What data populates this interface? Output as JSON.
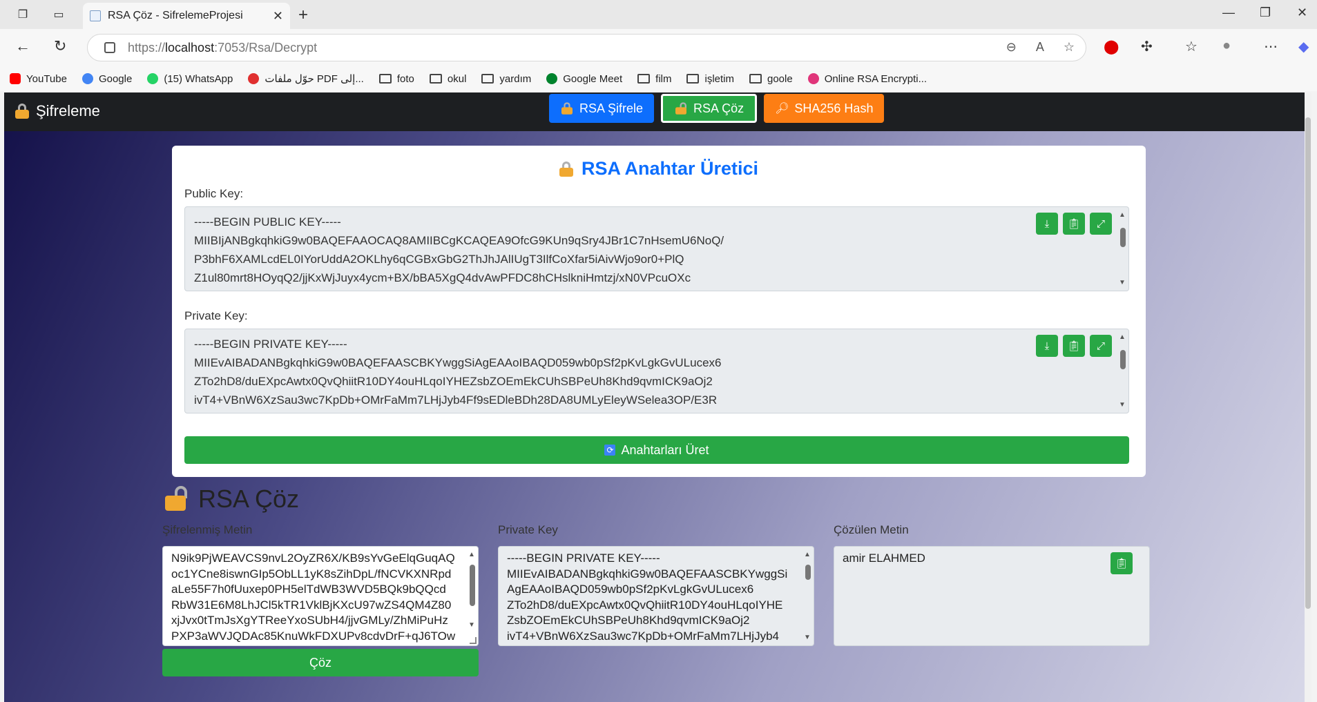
{
  "browser": {
    "tab_title": "RSA Çöz - SifrelemeProjesi",
    "url_prefix": "https://",
    "url_host": "localhost",
    "url_rest": ":7053/Rsa/Decrypt",
    "bookmarks": [
      {
        "label": "YouTube",
        "icon": "youtube-icon",
        "color": "#ff0000"
      },
      {
        "label": "Google",
        "icon": "google-icon",
        "color": "#4285f4"
      },
      {
        "label": "(15) WhatsApp",
        "icon": "whatsapp-icon",
        "color": "#25d366"
      },
      {
        "label": "حوّل ملفات PDF إلى...",
        "icon": "heart-icon",
        "color": "#e03030"
      },
      {
        "label": "foto",
        "icon": "folder-icon"
      },
      {
        "label": "okul",
        "icon": "folder-icon"
      },
      {
        "label": "yardım",
        "icon": "folder-icon"
      },
      {
        "label": "Google Meet",
        "icon": "meet-icon",
        "color": "#00832d"
      },
      {
        "label": "film",
        "icon": "folder-icon"
      },
      {
        "label": "işletim",
        "icon": "folder-icon"
      },
      {
        "label": "goole",
        "icon": "folder-icon"
      },
      {
        "label": "Online RSA Encrypti...",
        "icon": "rsa-site-icon",
        "color": "#e0357a"
      }
    ]
  },
  "app": {
    "brand": "Şifreleme",
    "nav": {
      "encrypt": "RSA Şifrele",
      "decrypt": "RSA Çöz",
      "hash": "SHA256 Hash"
    },
    "colors": {
      "blue": "#0d6efd",
      "green": "#28a745",
      "orange": "#fd7e14"
    }
  },
  "generator": {
    "title": "RSA Anahtar Üretici",
    "public_label": "Public Key:",
    "public_key": "-----BEGIN PUBLIC KEY-----\nMIIBIjANBgkqhkiG9w0BAQEFAAOCAQ8AMIIBCgKCAQEA9OfcG9KUn9qSry4JBr1C7nHsemU6NoQ/\nP3bhF6XAMLcdEL0IYorUddA2OKLhy6qCGBxGbG2ThJhJAlIUgT3IlfCoXfar5iAivWjo9or0+PlQ\nZ1ul80mrt8HOyqQ2/jjKxWjJuyx4ycm+BX/bBA5XgQ4dvAwPFDC8hCHslkniHmtzj/xN0VPcuOXc",
    "private_label": "Private Key:",
    "private_key": "-----BEGIN PRIVATE KEY-----\nMIIEvAIBADANBgkqhkiG9w0BAQEFAASCBKYwggSiAgEAAoIBAQD059wb0pSf2pKvLgkGvULucex6\nZTo2hD8/duEXpcAwtx0QvQhiitR10DY4ouHLqoIYHEZsbZOEmEkCUhSBPeUh8Khd9qvmICK9aOj2\nivT4+VBnW6XzSau3wc7KpDb+OMrFaMm7LHjJyb4Ff9sEDleBDh28DA8UMLyEleyWSelea3OP/E3R",
    "generate_label": "Anahtarları Üret"
  },
  "decrypt": {
    "title": "RSA Çöz",
    "cipher_label": "Şifrelenmiş Metin",
    "cipher_text": "N9ik9PjWEAVCS9nvL2OyZR6X/KB9sYvGeElqGuqAQ\noc1YCne8iswnGIp5ObLL1yK8sZihDpL/fNCVKXNRpd\naLe55F7h0fUuxep0PH5elTdWB3WVD5BQk9bQQcd\nRbW31E6M8LhJCl5kTR1VklBjKXcU97wZS4QM4Z80\nxjJvx0tTmJsXgYTReeYxoSUbH4/jjvGMLy/ZhMiPuHz\nPXP3aWVJQDAc85KnuWkFDXUPv8cdvDrF+qJ6TOw",
    "key_label": "Private Key",
    "key_text": "-----BEGIN PRIVATE KEY-----\nMIIEvAIBADANBgkqhkiG9w0BAQEFAASCBKYwggSi\nAgEAAoIBAQD059wb0pSf2pKvLgkGvULucex6\nZTo2hD8/duEXpcAwtx0QvQhiitR10DY4ouHLqoIYHE\nZsbZOEmEkCUhSBPeUh8Khd9qvmICK9aOj2\nivT4+VBnW6XzSau3wc7KpDb+OMrFaMm7LHjJyb4",
    "result_label": "Çözülen Metin",
    "result_text": "amir ELAHMED",
    "button_label": "Çöz"
  }
}
